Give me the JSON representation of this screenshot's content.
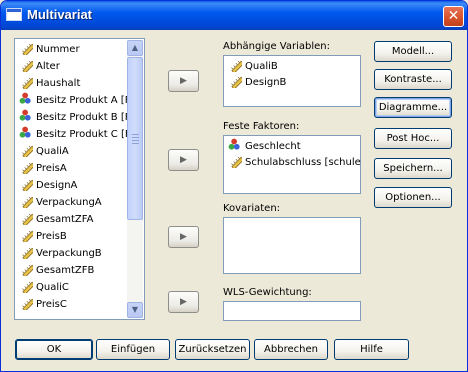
{
  "window": {
    "title": "Multivariat",
    "close_symbol": "✕"
  },
  "variables": {
    "items": [
      {
        "label": "Nummer",
        "icon": "ruler-icon"
      },
      {
        "label": "Alter",
        "icon": "ruler-icon"
      },
      {
        "label": "Haushalt",
        "icon": "ruler-icon"
      },
      {
        "label": "Besitz Produkt A [F",
        "icon": "nominal-icon"
      },
      {
        "label": "Besitz Produkt B [F",
        "icon": "nominal-icon"
      },
      {
        "label": "Besitz Produkt C [F",
        "icon": "nominal-icon"
      },
      {
        "label": "QualiA",
        "icon": "ruler-icon"
      },
      {
        "label": "PreisA",
        "icon": "ruler-icon"
      },
      {
        "label": "DesignA",
        "icon": "ruler-icon"
      },
      {
        "label": "VerpackungA",
        "icon": "ruler-icon"
      },
      {
        "label": "GesamtZFA",
        "icon": "ruler-icon"
      },
      {
        "label": "PreisB",
        "icon": "ruler-icon"
      },
      {
        "label": "VerpackungB",
        "icon": "ruler-icon"
      },
      {
        "label": "GesamtZFB",
        "icon": "ruler-icon"
      },
      {
        "label": "QualiC",
        "icon": "ruler-icon"
      },
      {
        "label": "PreisC",
        "icon": "ruler-icon"
      }
    ],
    "scroll_up": "▲",
    "scroll_down": "▼"
  },
  "arrow_symbol": "▶",
  "dependent": {
    "label": "Abhängige Variablen:",
    "items": [
      {
        "label": "QualiB",
        "icon": "ruler-icon"
      },
      {
        "label": "DesignB",
        "icon": "ruler-icon"
      }
    ]
  },
  "fixed_factors": {
    "label": "Feste Faktoren:",
    "items": [
      {
        "label": "Geschlecht",
        "icon": "nominal-icon"
      },
      {
        "label": "Schulabschluss [schule",
        "icon": "ruler-icon"
      }
    ]
  },
  "covariates": {
    "label": "Kovariaten:"
  },
  "wls": {
    "label": "WLS-Gewichtung:",
    "value": ""
  },
  "side_buttons": {
    "model": "Modell...",
    "contrasts": "Kontraste...",
    "plots": "Diagramme...",
    "posthoc": "Post Hoc...",
    "save": "Speichern...",
    "options": "Optionen..."
  },
  "bottom_buttons": {
    "ok": "OK",
    "paste": "Einfügen",
    "reset": "Zurücksetzen",
    "cancel": "Abbrechen",
    "help": "Hilfe"
  },
  "colors": {
    "titlebar": "#0058ee",
    "dialog_bg": "#ece9d8",
    "ruler_icon": "#d8b640",
    "nominal_red": "#d63a2a",
    "nominal_green": "#3aa845",
    "nominal_blue": "#3b63d9"
  }
}
